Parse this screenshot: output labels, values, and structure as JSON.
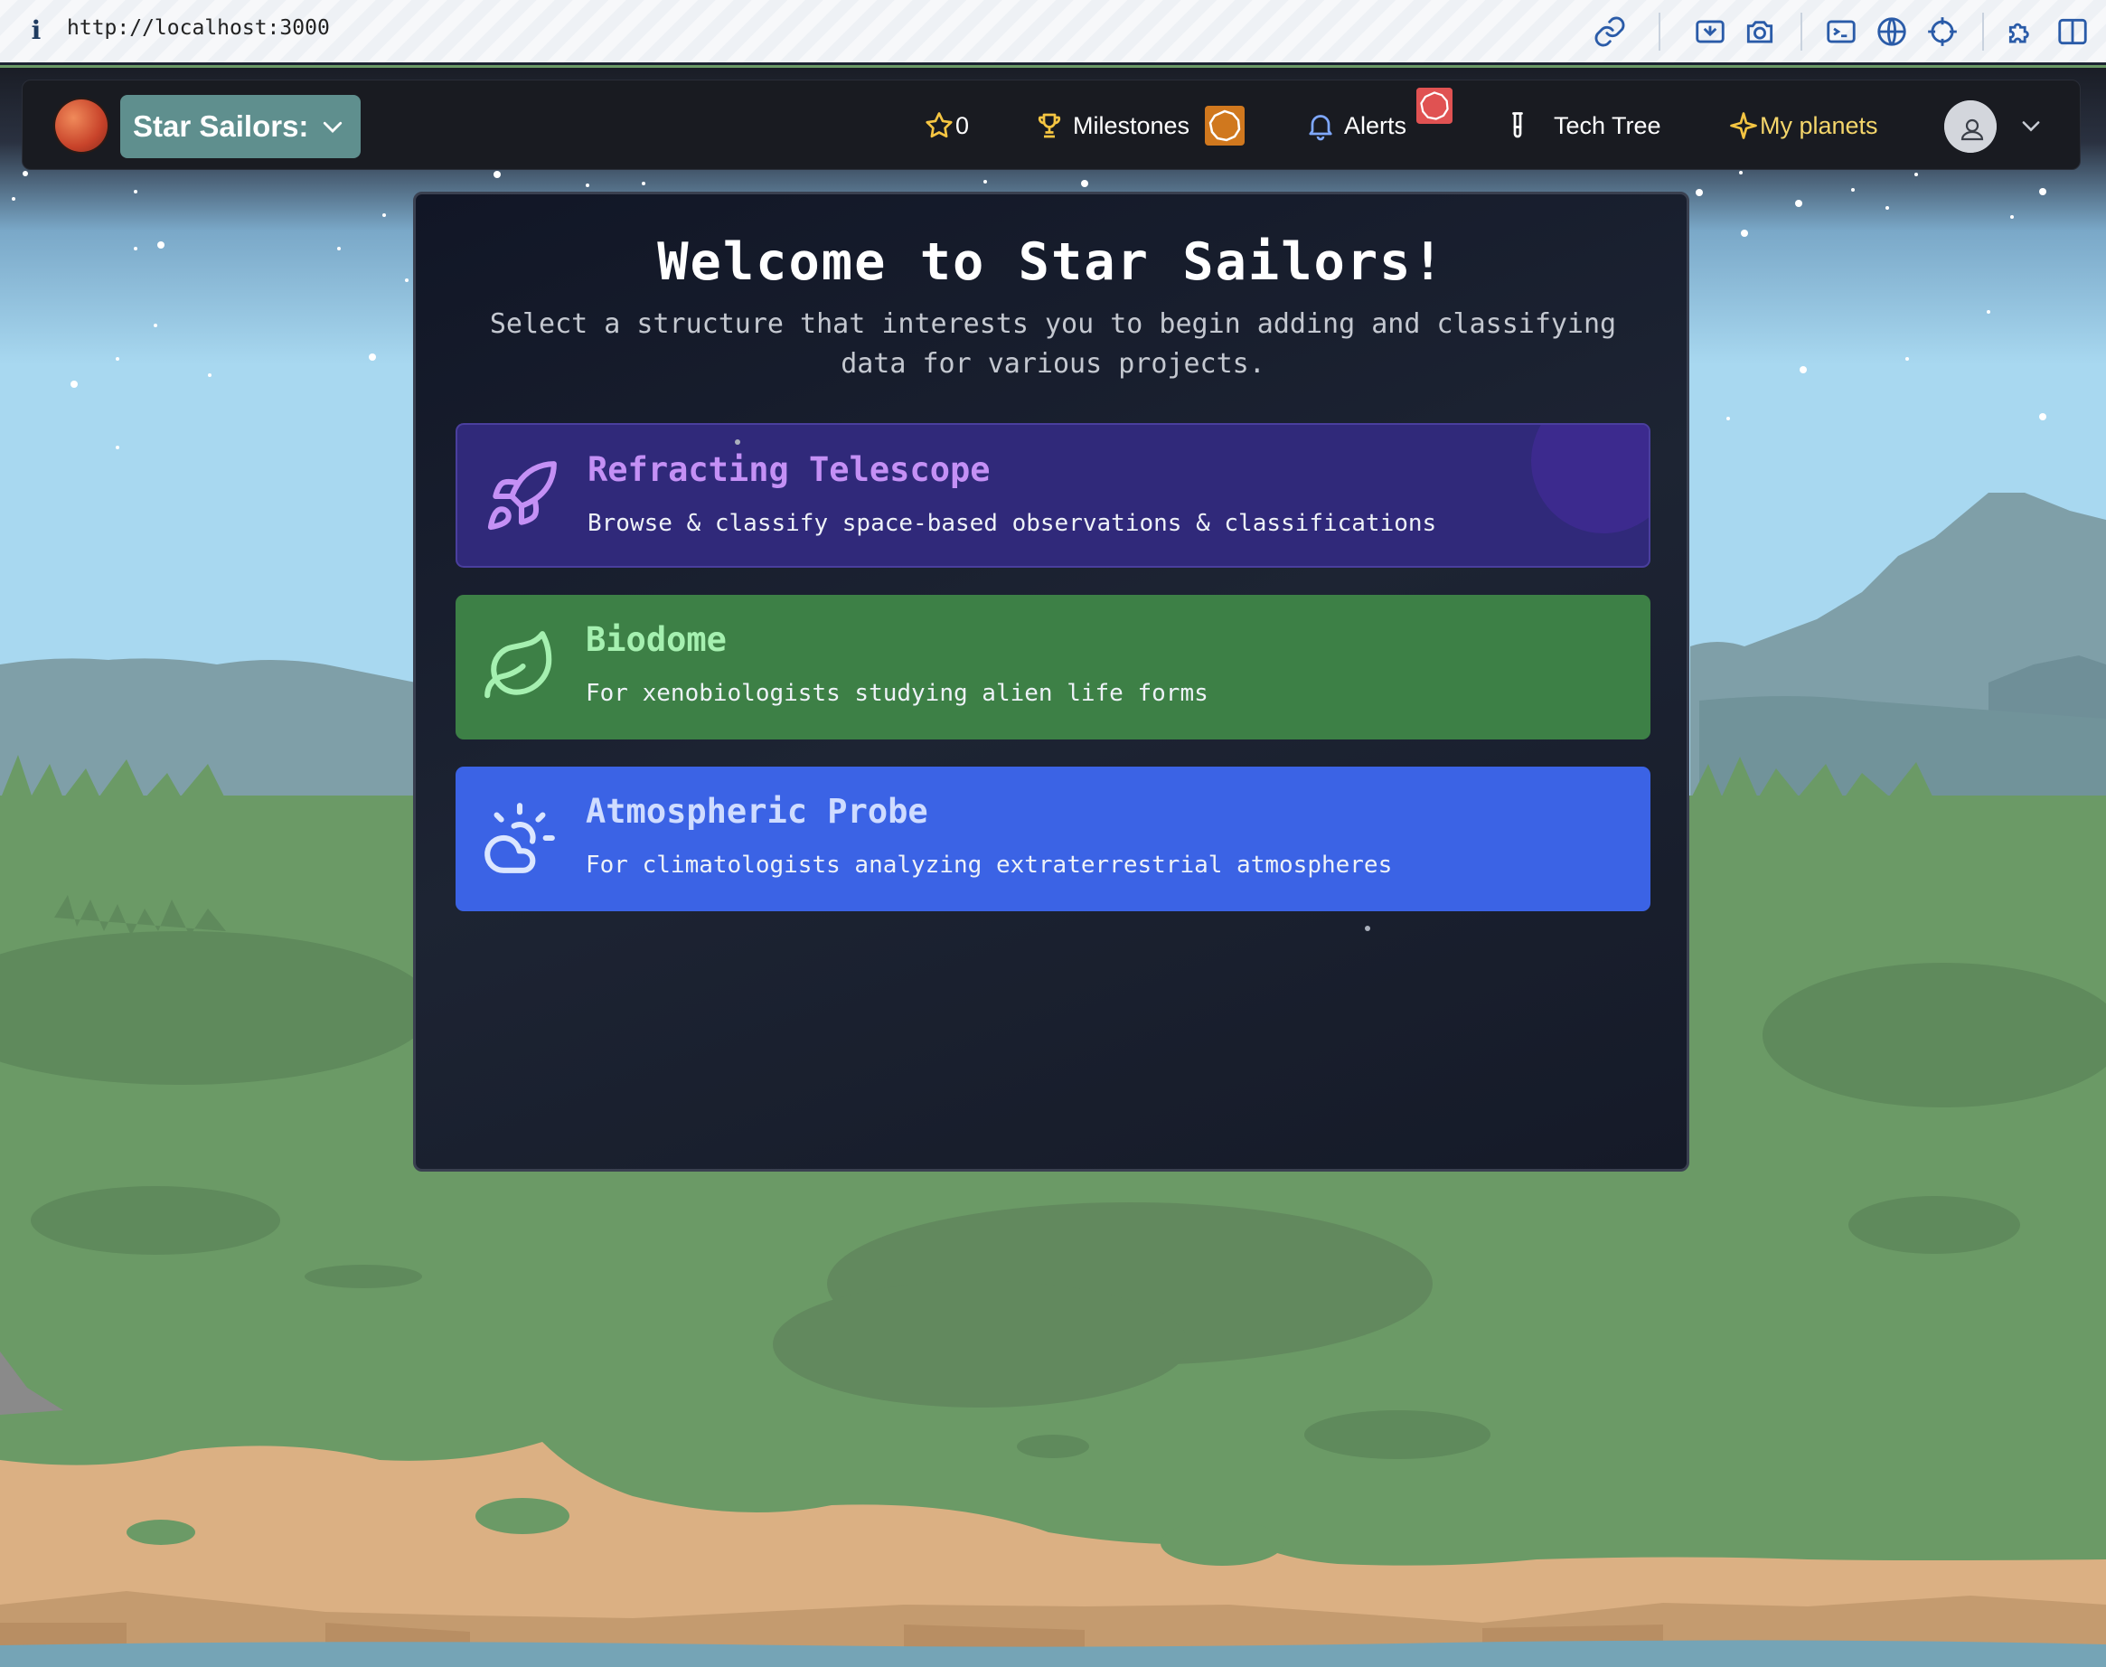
{
  "browser": {
    "url": "http://localhost:3000",
    "toolbar_icons": [
      "link-icon",
      "cast-icon",
      "camera-icon",
      "terminal-icon",
      "globe-icon",
      "crosshair-icon",
      "extensions-icon",
      "sidebar-icon"
    ]
  },
  "navbar": {
    "brand": "Star Sailors:",
    "stars_count": "0",
    "milestones_label": "Milestones",
    "alerts_label": "Alerts",
    "tech_tree_label": "Tech Tree",
    "my_planets_label": "My planets"
  },
  "colors": {
    "accent_teal": "#5f8f8e",
    "telescope": "#30297a",
    "biodome": "#3d8046",
    "probe": "#3b63e5",
    "star_icon": "#f5c542",
    "alert_badge": "#e05252",
    "milestone_badge": "#d0781e"
  },
  "main": {
    "title": "Welcome to Star Sailors!",
    "subtitle": "Select a structure that interests you to begin adding and classifying data for various projects.",
    "structures": [
      {
        "icon": "rocket-icon",
        "title": "Refracting Telescope",
        "description": "Browse & classify space-based observations & classifications"
      },
      {
        "icon": "leaf-icon",
        "title": "Biodome",
        "description": "For xenobiologists studying alien life forms"
      },
      {
        "icon": "cloud-sun-icon",
        "title": "Atmospheric Probe",
        "description": "For climatologists analyzing extraterrestrial atmospheres"
      }
    ]
  }
}
